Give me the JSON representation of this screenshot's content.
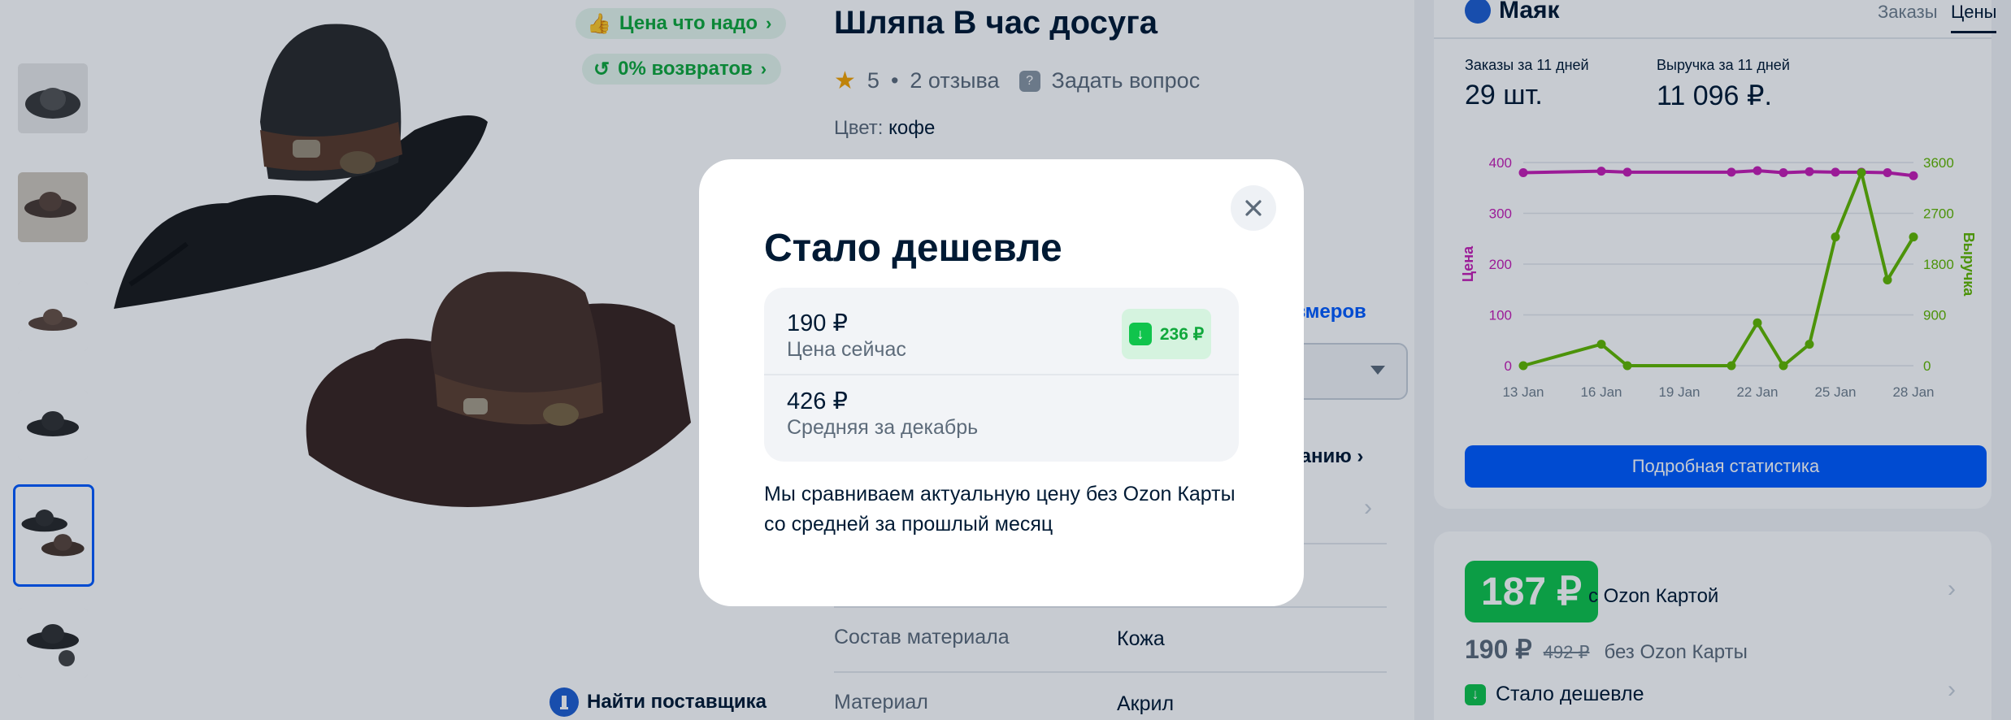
{
  "product": {
    "title": "Шляпа В час досуга",
    "rating": "5",
    "reviews": "2 отзыва",
    "ask_question": "Задать вопрос",
    "color_label": "Цвет:",
    "color_value": "кофе",
    "sizes_link": "размеров",
    "description_link": "санию",
    "attributes": [
      {
        "label": "Состав материала",
        "value": "Кожа"
      },
      {
        "label": "Материал",
        "value": "Акрил"
      }
    ]
  },
  "badges": {
    "good_price": "Цена что надо",
    "returns": "0% возвратов"
  },
  "supplier": {
    "label": "Найти поставщика"
  },
  "panel": {
    "brand": "Маяк",
    "tabs": [
      "Заказы",
      "Цены"
    ],
    "active_tab": "Цены",
    "orders_label": "Заказы за 11 дней",
    "orders_value": "29 шт.",
    "revenue_label": "Выручка за 11 дней",
    "revenue_value": "11 096 ₽.",
    "stats_button": "Подробная статистика"
  },
  "chart_data": {
    "type": "line",
    "x_ticks": [
      "13 Jan",
      "16 Jan",
      "19 Jan",
      "22 Jan",
      "25 Jan",
      "28 Jan"
    ],
    "ylabel_left": "Цена",
    "ylabel_right": "Выручка",
    "ylim_left": [
      0,
      400
    ],
    "ylim_right": [
      0,
      3600
    ],
    "y_ticks_left": [
      0,
      100,
      200,
      300,
      400
    ],
    "y_ticks_right": [
      0,
      900,
      1800,
      2700,
      3600
    ],
    "grid": true,
    "series": [
      {
        "name": "Цена",
        "color": "#c71eb5",
        "axis": "left",
        "x": [
          13,
          16,
          17,
          21,
          22,
          23,
          24,
          25,
          26,
          27,
          28
        ],
        "values": [
          380,
          383,
          381,
          381,
          384,
          380,
          382,
          381,
          381,
          380,
          374
        ]
      },
      {
        "name": "Выручка",
        "color": "#62b800",
        "axis": "right",
        "x": [
          13,
          16,
          17,
          21,
          22,
          23,
          24,
          25,
          26,
          27,
          28
        ],
        "values": [
          0,
          380,
          0,
          0,
          760,
          0,
          380,
          2280,
          3420,
          1520,
          2280
        ]
      }
    ]
  },
  "price_card": {
    "card_price": "187 ₽",
    "with_card": "с Ozon Картой",
    "base_price": "190 ₽",
    "old_price": "492 ₽",
    "without_card": "без Ozon Карты",
    "cheaper": "Стало дешевле"
  },
  "modal": {
    "title": "Стало дешевле",
    "current_price": "190 ₽",
    "current_label": "Цена сейчас",
    "drop_value": "236 ₽",
    "avg_price": "426 ₽",
    "avg_label": "Средняя за декабрь",
    "text": "Мы сравниваем актуальную цену без Ozon Карты со средней за прошлый месяц"
  },
  "colors": {
    "accent": "#005bff",
    "green": "#10c44c",
    "price_line": "#c71eb5",
    "revenue_line": "#62b800"
  }
}
